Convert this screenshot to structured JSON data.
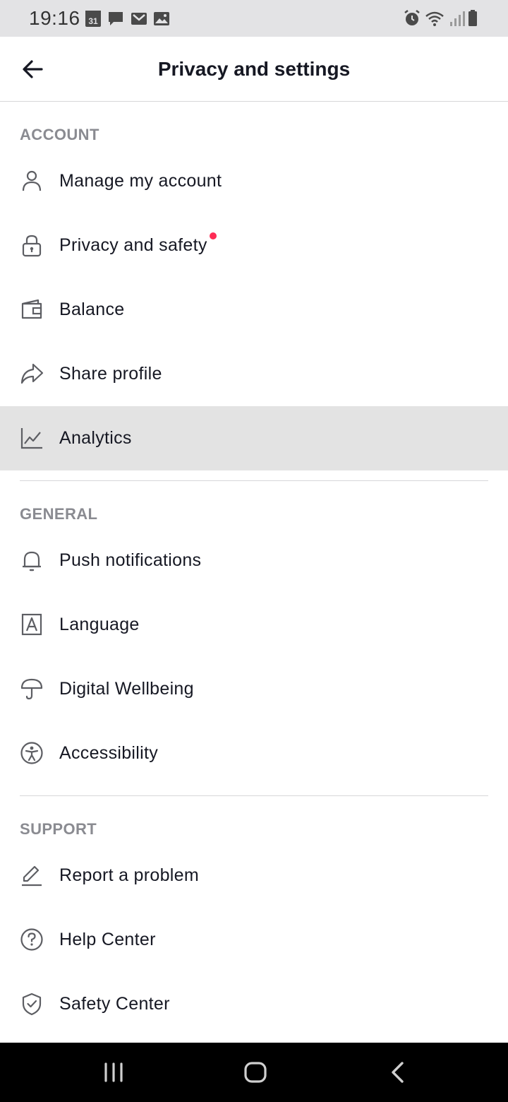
{
  "status_bar": {
    "time": "19:16",
    "calendar_day": "31",
    "left_icons": [
      "calendar-icon",
      "message-icon",
      "gmail-icon",
      "gallery-icon"
    ],
    "right_icons": [
      "alarm-icon",
      "wifi-icon",
      "signal-icon",
      "battery-icon"
    ]
  },
  "header": {
    "title": "Privacy and settings",
    "back_icon": "back-arrow-icon"
  },
  "sections": {
    "account": {
      "title": "ACCOUNT",
      "items": [
        {
          "label": "Manage my account",
          "icon": "person-icon"
        },
        {
          "label": "Privacy and safety",
          "icon": "lock-icon",
          "badge": true
        },
        {
          "label": "Balance",
          "icon": "wallet-icon"
        },
        {
          "label": "Share profile",
          "icon": "share-icon"
        },
        {
          "label": "Analytics",
          "icon": "analytics-icon",
          "highlighted": true
        }
      ]
    },
    "general": {
      "title": "GENERAL",
      "items": [
        {
          "label": "Push notifications",
          "icon": "bell-icon"
        },
        {
          "label": "Language",
          "icon": "language-icon"
        },
        {
          "label": "Digital Wellbeing",
          "icon": "umbrella-icon"
        },
        {
          "label": "Accessibility",
          "icon": "accessibility-icon"
        }
      ]
    },
    "support": {
      "title": "SUPPORT",
      "items": [
        {
          "label": "Report a problem",
          "icon": "pencil-icon"
        },
        {
          "label": "Help Center",
          "icon": "help-icon"
        },
        {
          "label": "Safety Center",
          "icon": "shield-icon"
        }
      ]
    }
  },
  "nav_bar": {
    "buttons": [
      "recent-apps-icon",
      "home-icon",
      "nav-back-icon"
    ]
  },
  "colors": {
    "badge": "#fe2c55",
    "highlight_row": "#e3e3e3",
    "section_title": "#8a8b91",
    "text": "#161823",
    "status_bar_bg": "#e3e3e5",
    "nav_bar_bg": "#000000"
  }
}
